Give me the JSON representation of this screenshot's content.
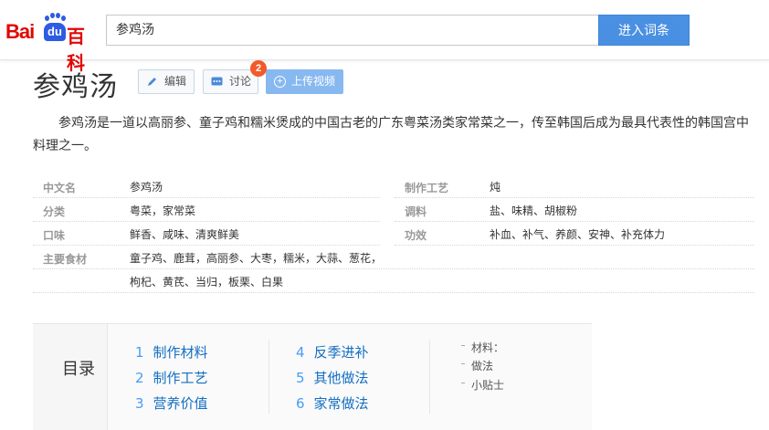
{
  "header": {
    "logo_text": "Bai du 百科",
    "logo_bai": "Bai",
    "logo_du": "du",
    "logo_baike": "百科",
    "search_value": "参鸡汤",
    "search_button": "进入词条"
  },
  "title": {
    "text": "参鸡汤",
    "edit_label": "编辑",
    "discuss_label": "讨论",
    "discuss_badge": "2",
    "upload_label": "上传视频"
  },
  "summary": "参鸡汤是一道以高丽参、童子鸡和糯米煲成的中国古老的广东粤菜汤类家常菜之一，传至韩国后成为最具代表性的韩国宫中料理之一。",
  "infobox": {
    "left": [
      {
        "key": "中文名",
        "value": "参鸡汤"
      },
      {
        "key": "分类",
        "value": "粤菜，家常菜"
      },
      {
        "key": "口味",
        "value": "鲜香、咸味、清爽鲜美"
      },
      {
        "key": "主要食材",
        "value": "童子鸡、鹿茸，高丽参、大枣，糯米，大蒜、葱花，"
      },
      {
        "key": "",
        "value": "枸杞、黄芪、当归，板栗、白果"
      }
    ],
    "right": [
      {
        "key": "制作工艺",
        "value": "炖"
      },
      {
        "key": "调料",
        "value": "盐、味精、胡椒粉"
      },
      {
        "key": "功效",
        "value": "补血、补气、养颜、安神、补充体力"
      }
    ]
  },
  "catalog": {
    "title": "目录",
    "items": [
      {
        "num": "1",
        "label": "制作材料"
      },
      {
        "num": "2",
        "label": "制作工艺"
      },
      {
        "num": "3",
        "label": "营养价值"
      },
      {
        "num": "4",
        "label": "反季进补"
      },
      {
        "num": "5",
        "label": "其他做法"
      },
      {
        "num": "6",
        "label": "家常做法"
      }
    ],
    "sub_items": [
      "材料：",
      "做法",
      "小贴士"
    ]
  },
  "colors": {
    "brand_red": "#e10602",
    "brand_blue": "#2d5be3",
    "search_button": "#4a90e2",
    "link": "#136ec2",
    "badge": "#f25a29"
  }
}
